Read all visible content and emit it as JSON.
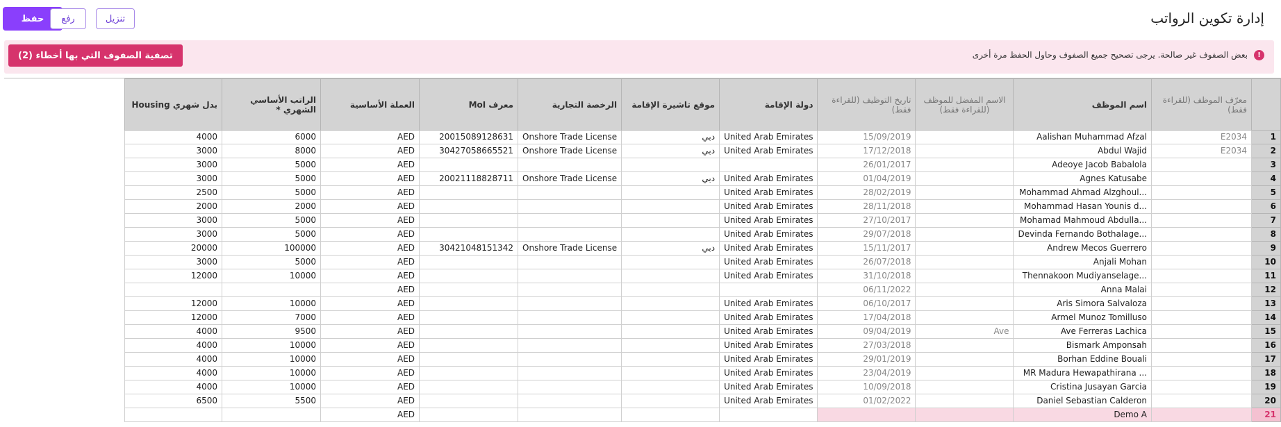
{
  "page": {
    "title": "إدارة تكوين الرواتب",
    "buttons": {
      "save": "حفظ",
      "upload": "رفع",
      "download": "تنزيل"
    }
  },
  "alert": {
    "icon": "alert-circle-icon",
    "message": "بعض الصفوف غير صالحة. يرجى تصحيح جميع الصفوف وحاول الحفظ مرة أخرى",
    "filter_button": "تصفية الصفوف التي بها أخطاء (2)",
    "color": "#d6336c"
  },
  "grid": {
    "columns": [
      "معرّف الموظف (للقراءة فقط)",
      "اسم الموظف",
      "الاسم المفضل للموظف (للقراءة فقط)",
      "تاريخ التوظيف (للقراءة فقط)",
      "دولة الإقامة",
      "موقع تاشيرة الإقامة",
      "الرخصة التجارية",
      "معرف MoI",
      "العملة الأساسية",
      "الراتب الأساسي الشهري *",
      "بدل شهري Housing"
    ],
    "rows": [
      {
        "n": "1",
        "id": "E2034",
        "name": "Aalishan Muhammad Afzal",
        "pref": "",
        "hire": "15/09/2019",
        "country": "United Arab Emirates",
        "visa": "دبي",
        "license": "Onshore Trade License",
        "moi": "20015089128631",
        "cur": "AED",
        "salary": "6000",
        "housing": "4000"
      },
      {
        "n": "2",
        "id": "E2034",
        "name": "Abdul Wajid",
        "pref": "",
        "hire": "17/12/2018",
        "country": "United Arab Emirates",
        "visa": "دبي",
        "license": "Onshore Trade License",
        "moi": "30427058665521",
        "cur": "AED",
        "salary": "8000",
        "housing": "3000"
      },
      {
        "n": "3",
        "id": "",
        "name": "Adeoye Jacob Babalola",
        "pref": "",
        "hire": "26/01/2017",
        "country": "",
        "visa": "",
        "license": "",
        "moi": "",
        "cur": "AED",
        "salary": "5000",
        "housing": "3000"
      },
      {
        "n": "4",
        "id": "",
        "name": "Agnes Katusabe",
        "pref": "",
        "hire": "01/04/2019",
        "country": "United Arab Emirates",
        "visa": "دبي",
        "license": "Onshore Trade License",
        "moi": "20021118828711",
        "cur": "AED",
        "salary": "5000",
        "housing": "3000"
      },
      {
        "n": "5",
        "id": "",
        "name": "Mohammad Ahmad Alzghoul...",
        "pref": "",
        "hire": "28/02/2019",
        "country": "United Arab Emirates",
        "visa": "",
        "license": "",
        "moi": "",
        "cur": "AED",
        "salary": "5000",
        "housing": "2500"
      },
      {
        "n": "6",
        "id": "",
        "name": "Mohammad Hasan Younis d...",
        "pref": "",
        "hire": "28/11/2018",
        "country": "United Arab Emirates",
        "visa": "",
        "license": "",
        "moi": "",
        "cur": "AED",
        "salary": "2000",
        "housing": "2000"
      },
      {
        "n": "7",
        "id": "",
        "name": "Mohamad Mahmoud Abdulla...",
        "pref": "",
        "hire": "27/10/2017",
        "country": "United Arab Emirates",
        "visa": "",
        "license": "",
        "moi": "",
        "cur": "AED",
        "salary": "5000",
        "housing": "3000"
      },
      {
        "n": "8",
        "id": "",
        "name": "Devinda Fernando Bothalage...",
        "pref": "",
        "hire": "29/07/2018",
        "country": "United Arab Emirates",
        "visa": "",
        "license": "",
        "moi": "",
        "cur": "AED",
        "salary": "5000",
        "housing": "3000"
      },
      {
        "n": "9",
        "id": "",
        "name": "Andrew Mecos Guerrero",
        "pref": "",
        "hire": "15/11/2017",
        "country": "United Arab Emirates",
        "visa": "دبي",
        "license": "Onshore Trade License",
        "moi": "30421048151342",
        "cur": "AED",
        "salary": "100000",
        "housing": "20000"
      },
      {
        "n": "10",
        "id": "",
        "name": "Anjali Mohan",
        "pref": "",
        "hire": "26/07/2018",
        "country": "United Arab Emirates",
        "visa": "",
        "license": "",
        "moi": "",
        "cur": "AED",
        "salary": "5000",
        "housing": "3000"
      },
      {
        "n": "11",
        "id": "",
        "name": "Thennakoon Mudiyanselage...",
        "pref": "",
        "hire": "31/10/2018",
        "country": "United Arab Emirates",
        "visa": "",
        "license": "",
        "moi": "",
        "cur": "AED",
        "salary": "10000",
        "housing": "12000"
      },
      {
        "n": "12",
        "id": "",
        "name": "Anna Malai",
        "pref": "",
        "hire": "06/11/2022",
        "country": "",
        "visa": "",
        "license": "",
        "moi": "",
        "cur": "AED",
        "salary": "",
        "housing": ""
      },
      {
        "n": "13",
        "id": "",
        "name": "Aris Simora Salvaloza",
        "pref": "",
        "hire": "06/10/2017",
        "country": "United Arab Emirates",
        "visa": "",
        "license": "",
        "moi": "",
        "cur": "AED",
        "salary": "10000",
        "housing": "12000"
      },
      {
        "n": "14",
        "id": "",
        "name": "Armel Munoz Tomilluso",
        "pref": "",
        "hire": "17/04/2018",
        "country": "United Arab Emirates",
        "visa": "",
        "license": "",
        "moi": "",
        "cur": "AED",
        "salary": "7000",
        "housing": "12000"
      },
      {
        "n": "15",
        "id": "",
        "name": "Ave Ferreras Lachica",
        "pref": "Ave",
        "hire": "09/04/2019",
        "country": "United Arab Emirates",
        "visa": "",
        "license": "",
        "moi": "",
        "cur": "AED",
        "salary": "9500",
        "housing": "4000"
      },
      {
        "n": "16",
        "id": "",
        "name": "Bismark Amponsah",
        "pref": "",
        "hire": "27/03/2018",
        "country": "United Arab Emirates",
        "visa": "",
        "license": "",
        "moi": "",
        "cur": "AED",
        "salary": "10000",
        "housing": "4000"
      },
      {
        "n": "17",
        "id": "",
        "name": "Borhan Eddine Bouali",
        "pref": "",
        "hire": "29/01/2019",
        "country": "United Arab Emirates",
        "visa": "",
        "license": "",
        "moi": "",
        "cur": "AED",
        "salary": "10000",
        "housing": "4000"
      },
      {
        "n": "18",
        "id": "",
        "name": "MR Madura Hewapathirana ...",
        "pref": "",
        "hire": "23/04/2019",
        "country": "United Arab Emirates",
        "visa": "",
        "license": "",
        "moi": "",
        "cur": "AED",
        "salary": "10000",
        "housing": "4000"
      },
      {
        "n": "19",
        "id": "",
        "name": "Cristina Jusayan Garcia",
        "pref": "",
        "hire": "10/09/2018",
        "country": "United Arab Emirates",
        "visa": "",
        "license": "",
        "moi": "",
        "cur": "AED",
        "salary": "10000",
        "housing": "4000"
      },
      {
        "n": "20",
        "id": "",
        "name": "Daniel Sebastian Calderon",
        "pref": "",
        "hire": "01/02/2022",
        "country": "United Arab Emirates",
        "visa": "",
        "license": "",
        "moi": "",
        "cur": "AED",
        "salary": "5500",
        "housing": "6500"
      },
      {
        "n": "21",
        "id": "",
        "name": "Demo A",
        "pref": "",
        "hire": "",
        "country": "",
        "visa": "",
        "license": "",
        "moi": "",
        "cur": "AED",
        "salary": "",
        "housing": "",
        "error": true
      }
    ]
  }
}
